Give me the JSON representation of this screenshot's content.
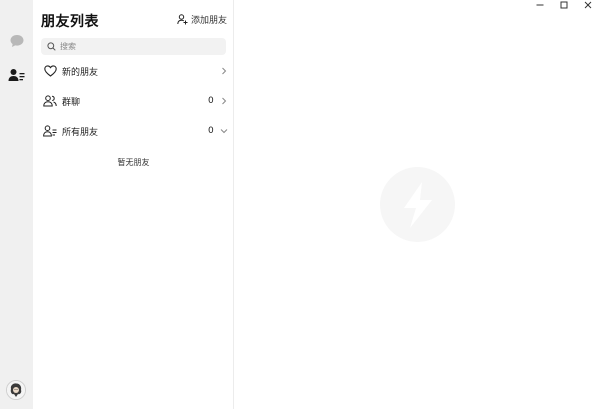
{
  "window": {
    "controls": [
      {
        "name": "minimize-button",
        "icon": "minimize-icon"
      },
      {
        "name": "maximize-button",
        "icon": "maximize-icon"
      },
      {
        "name": "close-button",
        "icon": "close-icon"
      }
    ]
  },
  "rail": {
    "items": [
      {
        "id": "chat",
        "icon": "chat-bubble-icon",
        "active": false
      },
      {
        "id": "contacts",
        "icon": "contacts-list-icon",
        "active": true
      }
    ],
    "avatar_icon": "user-avatar-icon"
  },
  "panel": {
    "title": "朋友列表",
    "add_friend_label": "添加朋友",
    "search": {
      "placeholder": "搜索",
      "value": ""
    },
    "rows": [
      {
        "id": "new-friends",
        "label": "新的朋友",
        "count": "",
        "icon": "heart-icon",
        "chevron": "chevron-right-icon"
      },
      {
        "id": "group-chats",
        "label": "群聊",
        "count": "0",
        "icon": "group-icon",
        "chevron": "chevron-right-icon"
      },
      {
        "id": "all-friends",
        "label": "所有朋友",
        "count": "0",
        "icon": "person-list-icon",
        "chevron": "chevron-down-icon"
      }
    ],
    "empty_text": "暂无朋友"
  },
  "colors": {
    "rail_bg": "#f0f0f0",
    "search_bg": "#f2f2f2",
    "logo_bg": "#f6f6f6",
    "text": "#222222"
  }
}
